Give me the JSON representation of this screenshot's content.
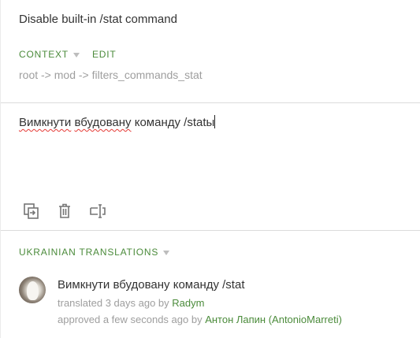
{
  "source": {
    "text": "Disable built-in /stat command"
  },
  "context": {
    "label": "CONTEXT",
    "edit_label": "EDIT",
    "path": "root -> mod -> filters_commands_stat"
  },
  "editor": {
    "word1": "Вимкнути",
    "space1": " ",
    "word2": "вбудовану",
    "rest": " команду /statы"
  },
  "toolbar": {
    "copy_icon": "copy-source-icon",
    "delete_icon": "trash-icon",
    "rtl_icon": "text-cursor-icon"
  },
  "translations": {
    "section_label": "UKRAINIAN TRANSLATIONS",
    "items": [
      {
        "text": "Вимкнути вбудовану команду /stat",
        "translated_prefix": "translated 3 days ago by ",
        "translator": "Radym",
        "approved_prefix": "approved a few seconds ago by ",
        "approver": "Антон Лапин (AntonioMarreti)"
      }
    ]
  },
  "colors": {
    "accent": "#4b8b3b",
    "muted": "#9e9e9e",
    "text": "#333333",
    "divider": "#dcdcdc",
    "spellcheck": "#e53935"
  }
}
